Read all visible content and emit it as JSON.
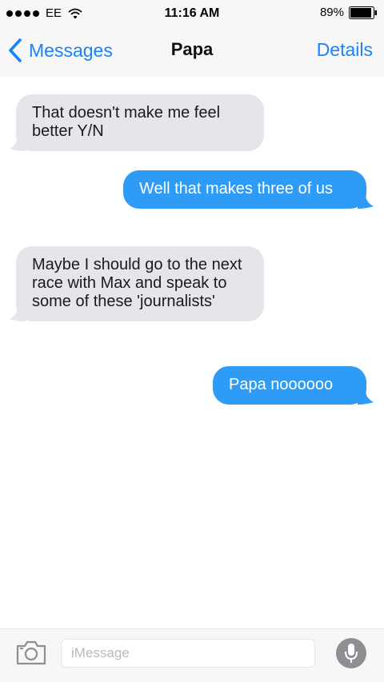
{
  "status_bar": {
    "carrier": "EE",
    "time": "11:16 AM",
    "battery": "89%",
    "signal_dots": 4
  },
  "nav": {
    "back_label": "Messages",
    "title": "Papa",
    "details_label": "Details"
  },
  "messages": [
    {
      "direction": "received",
      "text": "That doesn't make me feel better Y/N"
    },
    {
      "direction": "sent",
      "text": "Well that makes three of us"
    },
    {
      "direction": "received",
      "text": "Maybe I should go to the next race with Max and speak to some of these 'journalists'"
    },
    {
      "direction": "sent",
      "text": "Papa noooooo"
    }
  ],
  "input": {
    "placeholder": "iMessage",
    "value": ""
  },
  "colors": {
    "accent": "#1a82fb",
    "sent_bubble": "#2e9cf6",
    "received_bubble": "#e5e5ea"
  },
  "icons": [
    "wifi-icon",
    "battery-icon",
    "chevron-left-icon",
    "camera-icon",
    "microphone-icon"
  ]
}
